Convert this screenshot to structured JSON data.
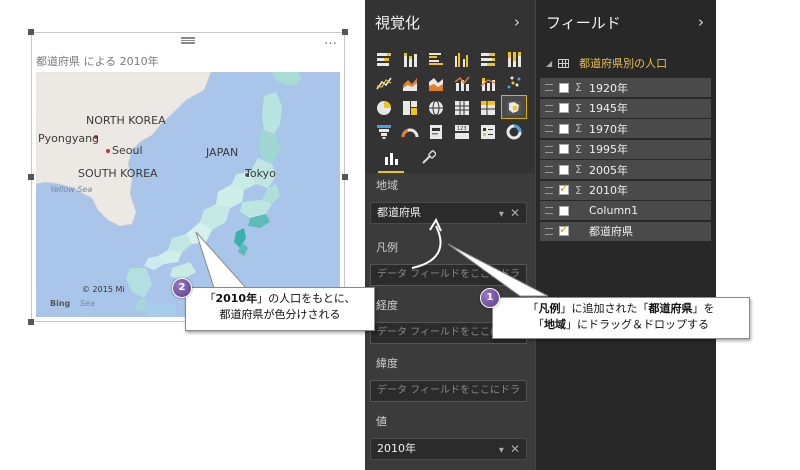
{
  "visual": {
    "title": "都道府県 による 2010年",
    "more_label": "…",
    "map": {
      "labels": {
        "north_korea": "NORTH KOREA",
        "pyongyang": "Pyongyang",
        "seoul": "Seoul",
        "south_korea": "SOUTH KOREA",
        "yellow_sea": "Yellow Sea",
        "japan": "JAPAN",
        "tokyo": "Tokyo",
        "copyright": "© 2015 Mi",
        "bing": "Bing",
        "sea_fragment": "Sea"
      },
      "colors": {
        "sea": "#a9c6ea",
        "land": "#ece9e4",
        "japan_fill": "#b8e0dc",
        "dark_pref": "#5bbcb8",
        "accent": "#3ab0ad"
      }
    }
  },
  "viz_pane": {
    "title": "視覚化",
    "chevron": "›",
    "icons": [
      "stacked-bar-icon",
      "stacked-column-icon",
      "clustered-bar-icon",
      "clustered-column-icon",
      "100-percent-bar-icon",
      "100-percent-column-icon",
      "line-chart-icon",
      "area-chart-icon",
      "stacked-area-icon",
      "line-column-icon",
      "line-stacked-column-icon",
      "scatter-icon",
      "pie-chart-icon",
      "treemap-icon",
      "map-icon",
      "table-icon",
      "matrix-icon",
      "filled-map-icon",
      "funnel-icon",
      "gauge-icon",
      "card-icon",
      "multi-row-card-icon",
      "slicer-icon",
      "donut-icon"
    ],
    "selected_icon_index": 17,
    "wells": [
      {
        "label": "地域",
        "value": "都道府県",
        "filled": true
      },
      {
        "label": "凡例",
        "value": "データ フィールドをここにドラ",
        "filled": false
      },
      {
        "label": "経度",
        "value": "データ フィールドをここにドラ",
        "filled": false
      },
      {
        "label": "緯度",
        "value": "データ フィールドをここにドラ",
        "filled": false
      },
      {
        "label": "値",
        "value": "2010年",
        "filled": true
      }
    ],
    "well_ctrl_dropdown": "▾",
    "well_ctrl_remove": "✕"
  },
  "fields_pane": {
    "title": "フィールド",
    "chevron": "›",
    "table_name": "都道府県別の人口",
    "fields": [
      {
        "name": "1920年",
        "sigma": true,
        "checked": false
      },
      {
        "name": "1945年",
        "sigma": true,
        "checked": false
      },
      {
        "name": "1970年",
        "sigma": true,
        "checked": false
      },
      {
        "name": "1995年",
        "sigma": true,
        "checked": false
      },
      {
        "name": "2005年",
        "sigma": true,
        "checked": false
      },
      {
        "name": "2010年",
        "sigma": true,
        "checked": true
      },
      {
        "name": "Column1",
        "sigma": false,
        "checked": false
      },
      {
        "name": "都道府県",
        "sigma": false,
        "checked": true
      }
    ],
    "sigma_glyph": "Σ"
  },
  "callouts": {
    "one": {
      "badge": "1",
      "line1_a": "「",
      "line1_b": "凡例",
      "line1_c": "」に追加された「",
      "line1_d": "都道府県",
      "line1_e": "」を",
      "line2_a": "「",
      "line2_b": "地域",
      "line2_c": "」にドラッグ＆ドロップする"
    },
    "two": {
      "badge": "2",
      "line1_a": "「",
      "line1_b": "2010年",
      "line1_c": "」の人口をもとに、",
      "line2": "都道府県が色分けされる"
    },
    "color_badge": "#6a4a9c"
  }
}
